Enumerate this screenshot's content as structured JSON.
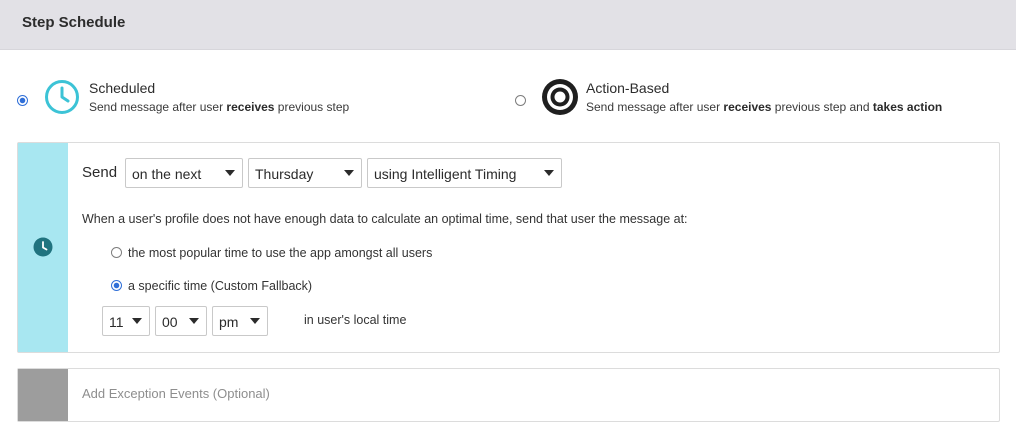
{
  "header": {
    "title": "Step Schedule"
  },
  "step_types": {
    "scheduled": {
      "title": "Scheduled",
      "desc_pre": "Send message after user ",
      "desc_bold": "receives",
      "desc_post": " previous step",
      "selected": true,
      "icon": "clock-icon"
    },
    "action_based": {
      "title": "Action-Based",
      "desc_pre": "Send message after user ",
      "desc_bold": "receives",
      "desc_mid": " previous step and ",
      "desc_bold2": "takes action",
      "selected": false,
      "icon": "target-icon"
    }
  },
  "schedule": {
    "send_label": "Send",
    "when_select": "on the next",
    "day_select": "Thursday",
    "timing_select": "using Intelligent Timing",
    "fallback_info": "When a user's profile does not have enough data to calculate an optimal time, send that user the message at:",
    "fallback_options": [
      {
        "label": "the most popular time to use the app amongst all users",
        "selected": false
      },
      {
        "label": "a specific time (Custom Fallback)",
        "selected": true
      }
    ],
    "hour": "11",
    "minute": "00",
    "ampm": "pm",
    "local_time_label": "in user's local time"
  },
  "exceptions": {
    "label": "Add Exception Events (Optional)"
  },
  "colors": {
    "accent": "#2f6fd8",
    "schedule_strip": "#a8e7f1",
    "clock_teal": "#3cc3d6",
    "strip_icon": "#20737f",
    "exception_strip": "#9d9d9d"
  }
}
